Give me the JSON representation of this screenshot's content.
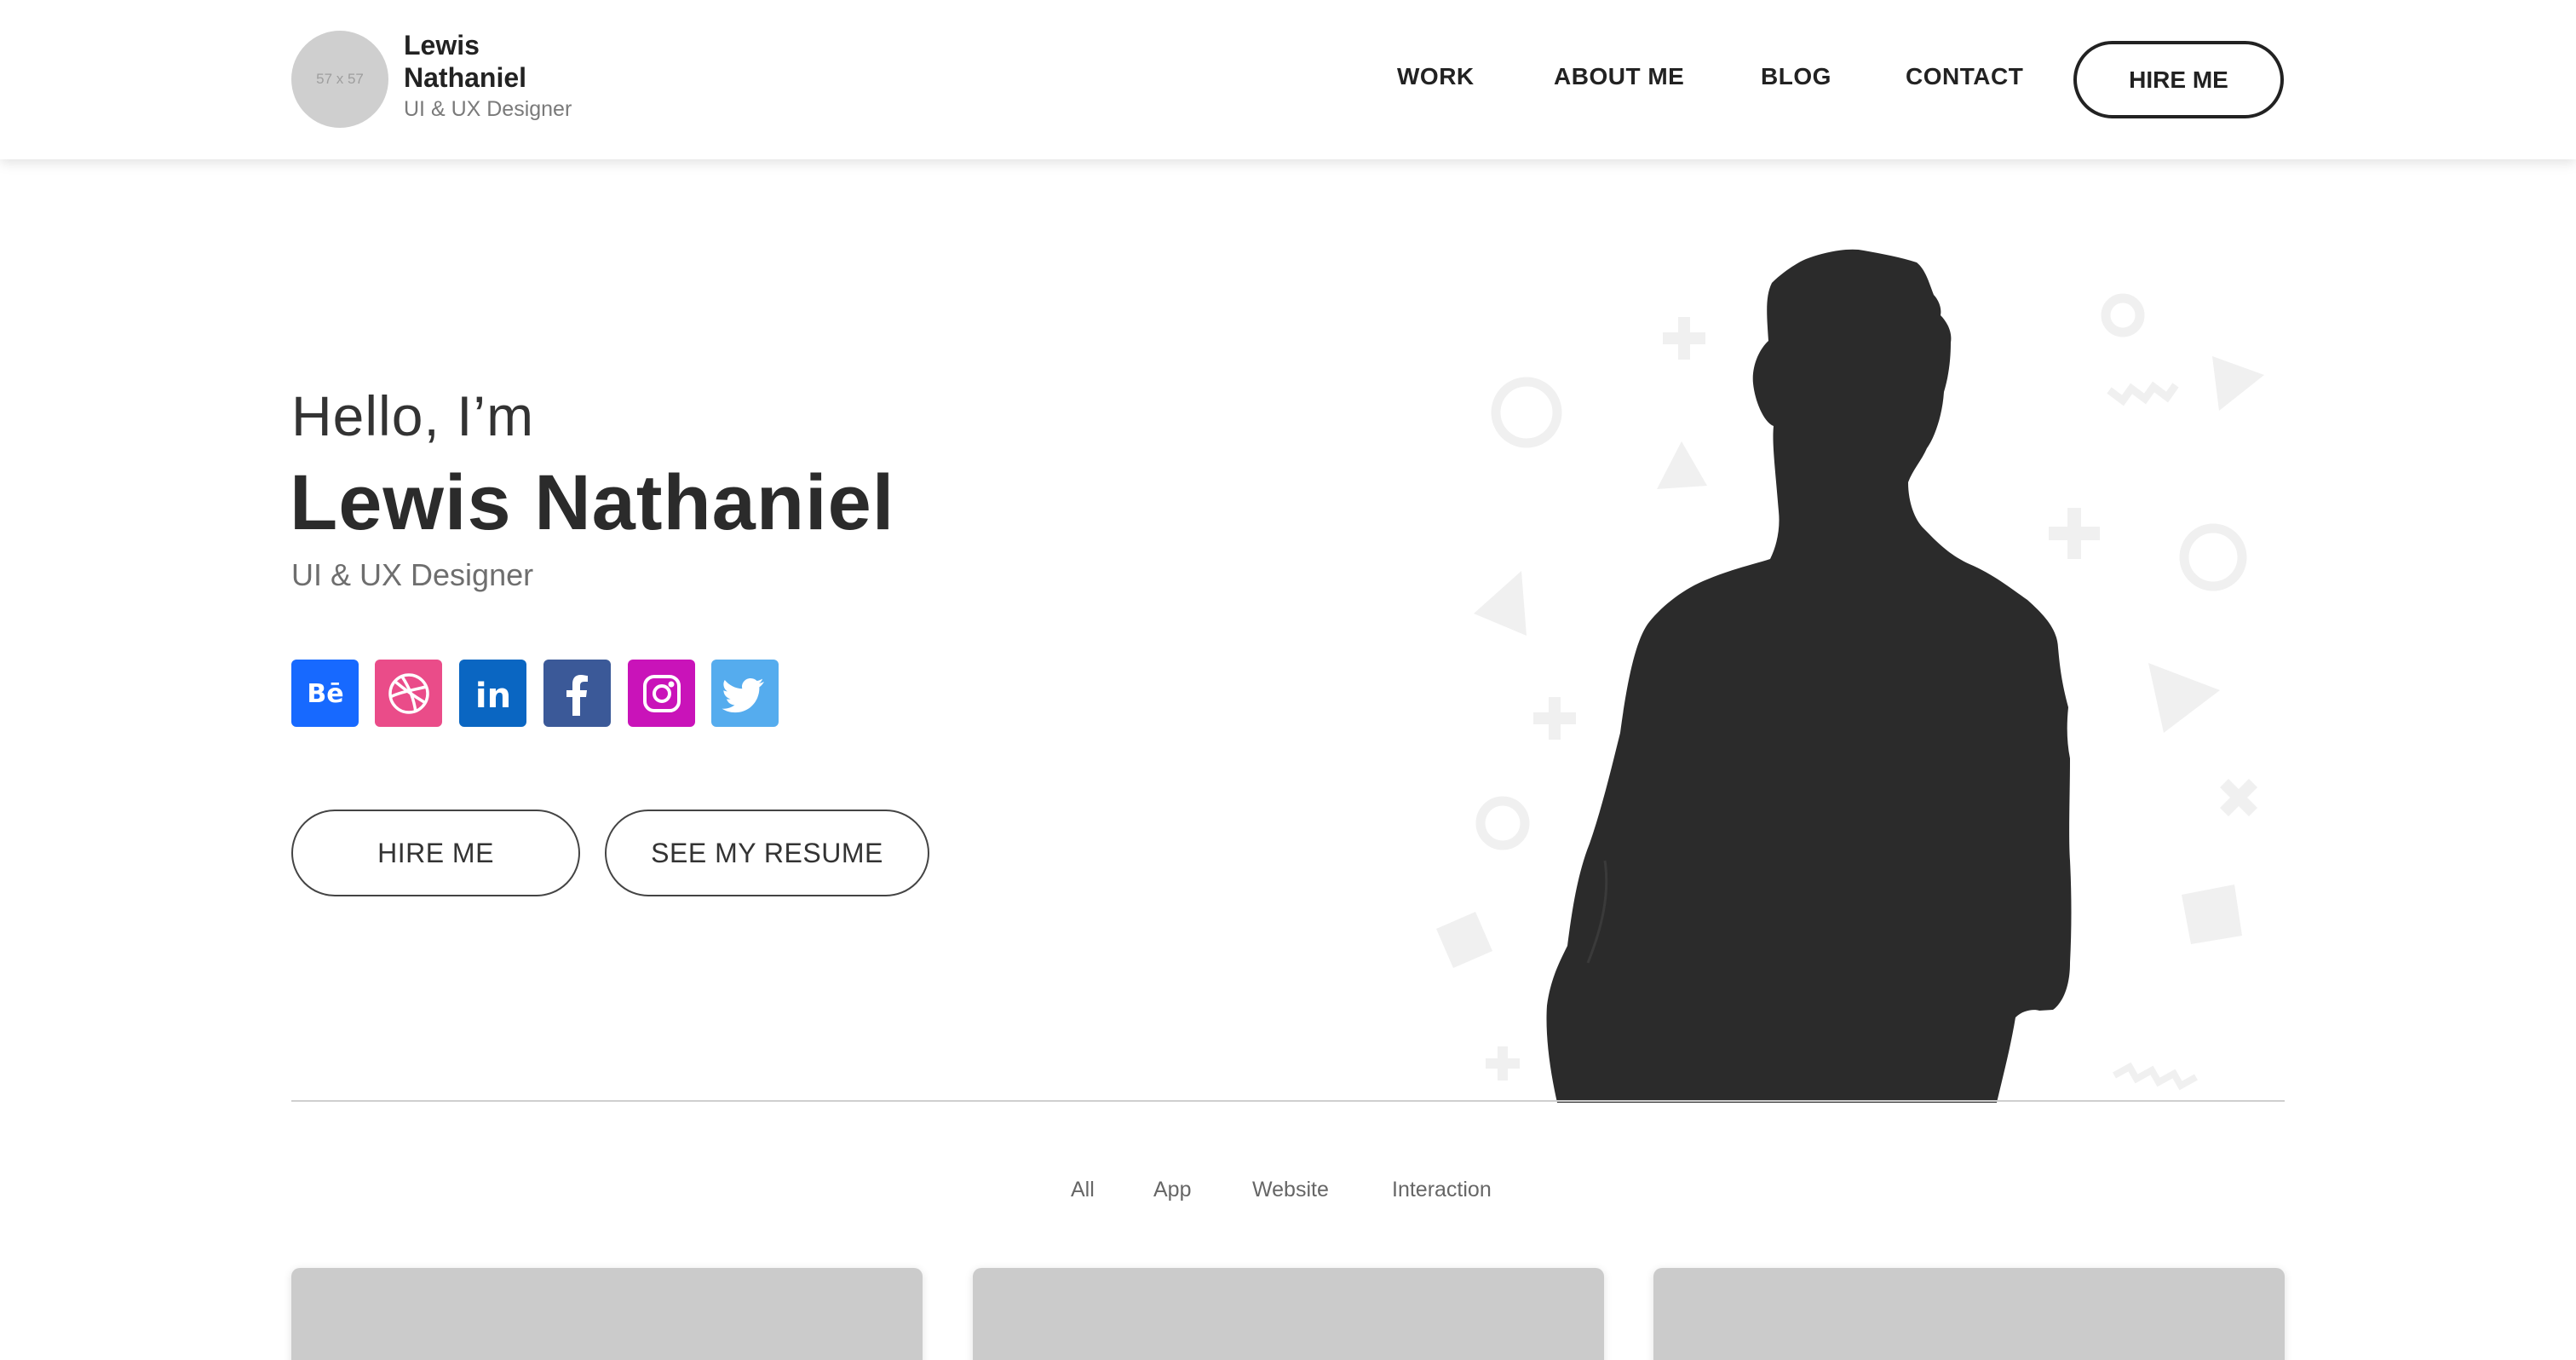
{
  "header": {
    "logo_placeholder": "57 x 57",
    "brand_name": "Lewis Nathaniel",
    "brand_role": "UI & UX Designer",
    "nav": [
      "WORK",
      "ABOUT ME",
      "BLOG",
      "CONTACT"
    ],
    "hire_label": "HIRE ME"
  },
  "hero": {
    "greeting": "Hello, I’m",
    "name": "Lewis Nathaniel",
    "role": "UI & UX Designer",
    "social": [
      {
        "icon": "behance-icon",
        "color": "#1769ff"
      },
      {
        "icon": "dribbble-icon",
        "color": "#ea4c89"
      },
      {
        "icon": "linkedin-icon",
        "color": "#0a66c2"
      },
      {
        "icon": "facebook-icon",
        "color": "#3b5998"
      },
      {
        "icon": "instagram-icon",
        "color": "#c913b9"
      },
      {
        "icon": "twitter-icon",
        "color": "#55acee"
      }
    ],
    "buttons": {
      "hire": "HIRE ME",
      "resume": "SEE MY RESUME"
    }
  },
  "filters": [
    "All",
    "App",
    "Website",
    "Interaction"
  ]
}
